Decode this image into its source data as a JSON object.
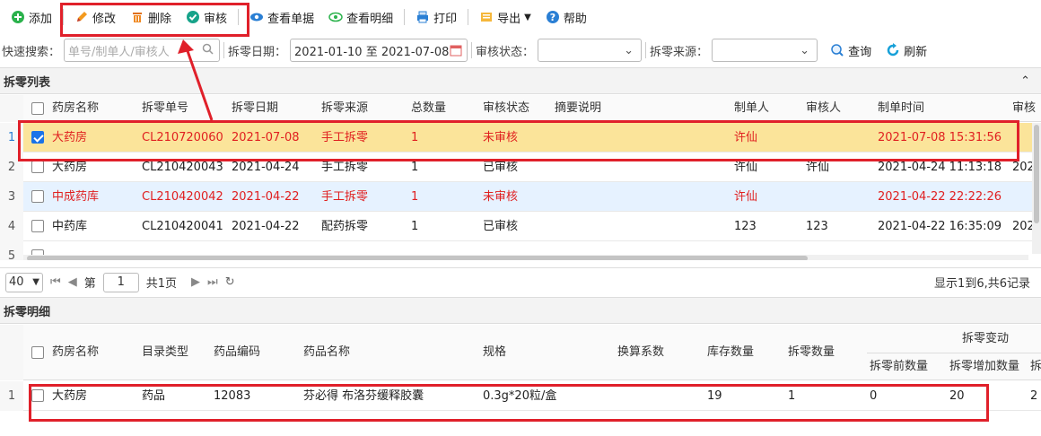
{
  "toolbar": {
    "add": "添加",
    "edit": "修改",
    "delete": "删除",
    "audit": "审核",
    "view_doc": "查看单据",
    "view_detail": "查看明细",
    "print": "打印",
    "export": "导出",
    "help": "帮助"
  },
  "search": {
    "quick_label": "快速搜索：",
    "quick_placeholder": "单号/制单人/审核人",
    "date_label": "拆零日期：",
    "date_value": "2021-01-10 至 2021-07-08",
    "status_label": "审核状态：",
    "source_label": "拆零来源：",
    "query": "查询",
    "refresh": "刷新"
  },
  "list": {
    "title": "拆零列表",
    "columns": [
      "药房名称",
      "拆零单号",
      "拆零日期",
      "拆零来源",
      "总数量",
      "审核状态",
      "摘要说明",
      "制单人",
      "审核人",
      "制单时间",
      "审核"
    ],
    "rows": [
      {
        "num": "1",
        "store": "大药房",
        "no": "CL210720060",
        "date": "2021-07-08",
        "source": "手工拆零",
        "qty": "1",
        "status": "未审核",
        "memo": "",
        "maker": "许仙",
        "auditor": "",
        "time": "2021-07-08 15:31:56",
        "audit": ""
      },
      {
        "num": "2",
        "store": "大药房",
        "no": "CL210420043",
        "date": "2021-04-24",
        "source": "手工拆零",
        "qty": "1",
        "status": "已审核",
        "memo": "",
        "maker": "许仙",
        "auditor": "许仙",
        "time": "2021-04-24 11:13:18",
        "audit": "202"
      },
      {
        "num": "3",
        "store": "中成药库",
        "no": "CL210420042",
        "date": "2021-04-22",
        "source": "手工拆零",
        "qty": "1",
        "status": "未审核",
        "memo": "",
        "maker": "许仙",
        "auditor": "",
        "time": "2021-04-22 22:22:26",
        "audit": ""
      },
      {
        "num": "4",
        "store": "中药库",
        "no": "CL210420041",
        "date": "2021-04-22",
        "source": "配药拆零",
        "qty": "1",
        "status": "已审核",
        "memo": "",
        "maker": "123",
        "auditor": "123",
        "time": "2021-04-22 16:35:09",
        "audit": "202"
      },
      {
        "num": "5",
        "store": "",
        "no": "",
        "date": "",
        "source": "",
        "qty": "",
        "status": "",
        "memo": "",
        "maker": "",
        "auditor": "",
        "time": "",
        "audit": ""
      }
    ]
  },
  "pager": {
    "page_size": "40",
    "page_label": "第",
    "page_value": "1",
    "total_pages": "共1页",
    "summary": "显示1到6,共6记录"
  },
  "detail": {
    "title": "拆零明细",
    "columns": [
      "药房名称",
      "目录类型",
      "药品编码",
      "药品名称",
      "规格",
      "换算系数",
      "库存数量",
      "拆零数量"
    ],
    "group_header": "拆零变动",
    "sub_columns": [
      "拆零前数量",
      "拆零增加数量",
      "拆"
    ],
    "rows": [
      {
        "num": "1",
        "store": "大药房",
        "type": "药品",
        "code": "12083",
        "name": "芬必得 布洛芬缓释胶囊",
        "spec": "0.3g*20粒/盒",
        "factor": "",
        "stock": "19",
        "split": "1",
        "before": "0",
        "add": "20",
        "extra": "2"
      }
    ]
  },
  "colors": {
    "accent": "#1a73e8",
    "danger": "#e02020",
    "selected": "#fbe49a",
    "hover": "#e6f2ff",
    "annotation": "#e0202a"
  }
}
